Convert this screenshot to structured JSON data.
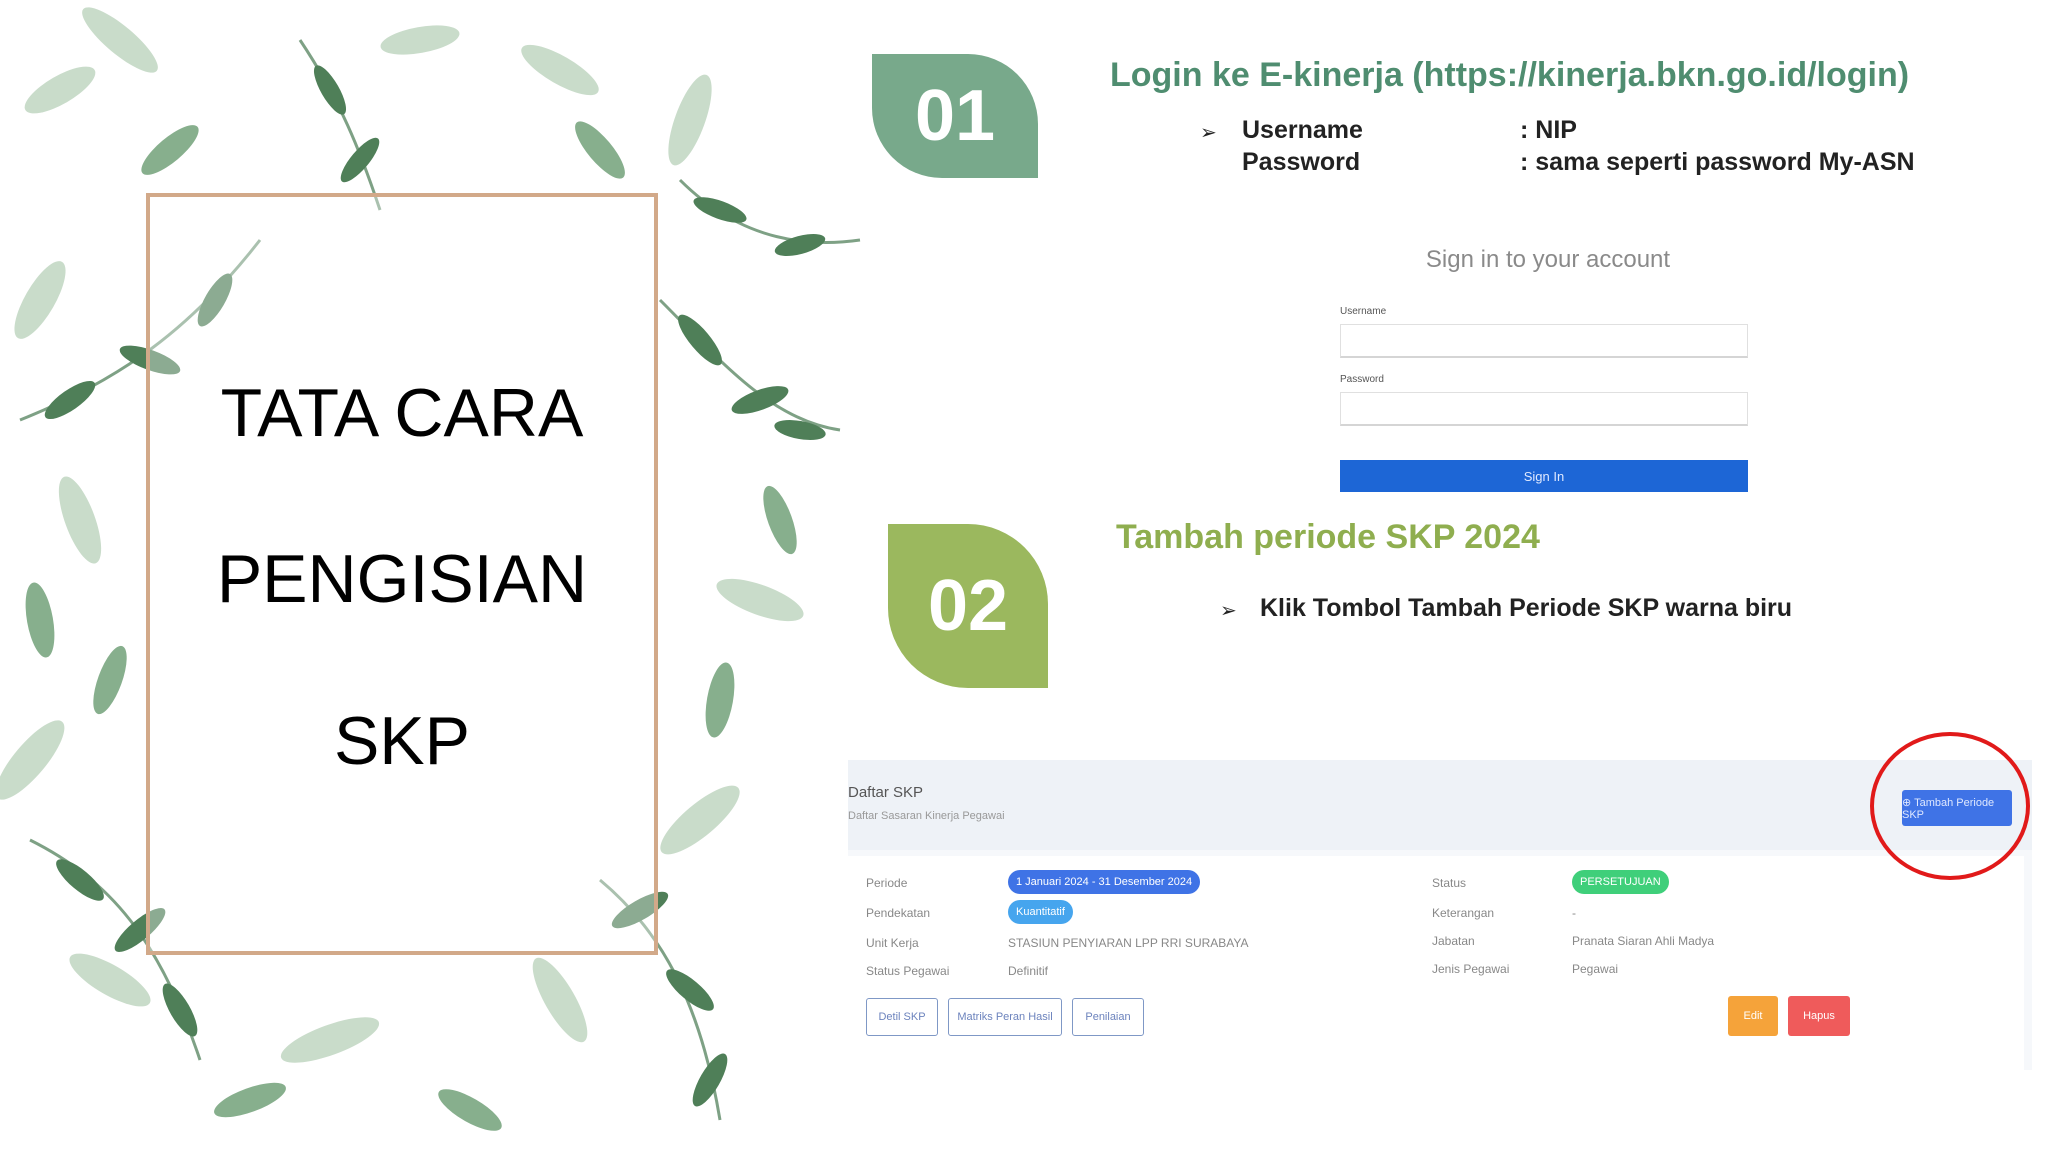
{
  "title_lines": [
    "TATA CARA",
    "PENGISIAN",
    "SKP"
  ],
  "step1": {
    "number": "01",
    "title": "Login ke E-kinerja (https://kinerja.bkn.go.id/login)",
    "bullet_marker": "➢",
    "username_label": "Username",
    "username_value": ": NIP",
    "password_label": "Password",
    "password_value": ": sama seperti password My-ASN"
  },
  "login_form": {
    "heading": "Sign in to your account",
    "username_label": "Username",
    "password_label": "Password",
    "button_label": "Sign In"
  },
  "step2": {
    "number": "02",
    "title": "Tambah periode SKP 2024",
    "bullet_marker": "➢",
    "bullet_text": "Klik Tombol Tambah Periode SKP warna biru"
  },
  "skp_list": {
    "title": "Daftar SKP",
    "subtitle": "Daftar Sasaran Kinerja Pegawai",
    "add_button": "⊕ Tambah Periode SKP",
    "rows_left": [
      {
        "label": "Periode",
        "value": "1 Januari 2024 - 31 Desember 2024"
      },
      {
        "label": "Pendekatan",
        "value": "Kuantitatif"
      },
      {
        "label": "Unit Kerja",
        "value": "STASIUN PENYIARAN LPP RRI SURABAYA"
      },
      {
        "label": "Status Pegawai",
        "value": "Definitif"
      }
    ],
    "rows_right": [
      {
        "label": "Status",
        "value": "PERSETUJUAN"
      },
      {
        "label": "Keterangan",
        "value": "-"
      },
      {
        "label": "Jabatan",
        "value": "Pranata Siaran Ahli Madya"
      },
      {
        "label": "Jenis Pegawai",
        "value": "Pegawai"
      }
    ],
    "buttons": [
      "Detil SKP",
      "Matriks Peran Hasil",
      "Penilaian"
    ],
    "edit_button": "Edit",
    "delete_button": "Hapus"
  },
  "colors": {
    "step1_accent": "#78a98b",
    "step2_accent": "#9bb85e",
    "frame": "#d2a989",
    "primary_blue": "#1d66d6",
    "highlight": "#e11a1a",
    "edit": "#f5a33a",
    "delete": "#ef5b5b",
    "status_green": "#3fcf7a",
    "periode_blue": "#3f73e6",
    "kuantitatif_blue": "#46a5ee"
  }
}
